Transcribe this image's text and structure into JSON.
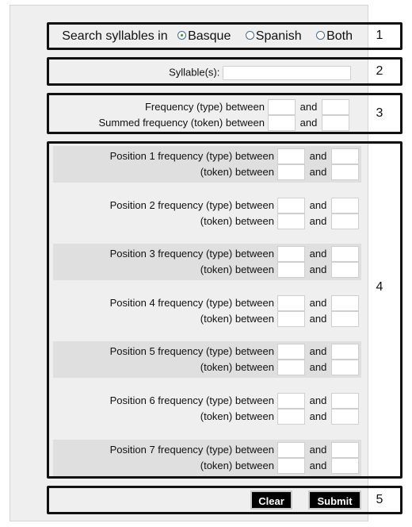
{
  "search_language": {
    "label": "Search syllables in",
    "options": [
      {
        "label": "Basque",
        "selected": true
      },
      {
        "label": "Spanish",
        "selected": false
      },
      {
        "label": "Both",
        "selected": false
      }
    ],
    "section_number": "1"
  },
  "syllables": {
    "label": "Syllable(s):",
    "value": "",
    "section_number": "2"
  },
  "frequency": {
    "rows": [
      {
        "label": "Frequency (type) between",
        "and": "and",
        "min": "",
        "max": ""
      },
      {
        "label": "Summed frequency (token) between",
        "and": "and",
        "min": "",
        "max": ""
      }
    ],
    "section_number": "3"
  },
  "positions": {
    "section_number": "4",
    "items": [
      {
        "type_label": "Position 1 frequency (type) between",
        "token_label": "(token) between",
        "and": "and"
      },
      {
        "type_label": "Position 2 frequency (type) between",
        "token_label": "(token) between",
        "and": "and"
      },
      {
        "type_label": "Position 3 frequency (type) between",
        "token_label": "(token) between",
        "and": "and"
      },
      {
        "type_label": "Position 4 frequency (type) between",
        "token_label": "(token) between",
        "and": "and"
      },
      {
        "type_label": "Position 5 frequency (type) between",
        "token_label": "(token) between",
        "and": "and"
      },
      {
        "type_label": "Position 6 frequency (type) between",
        "token_label": "(token) between",
        "and": "and"
      },
      {
        "type_label": "Position 7 frequency (type) between",
        "token_label": "(token) between",
        "and": "and"
      }
    ]
  },
  "actions": {
    "clear_label": "Clear",
    "submit_label": "Submit",
    "section_number": "5"
  }
}
